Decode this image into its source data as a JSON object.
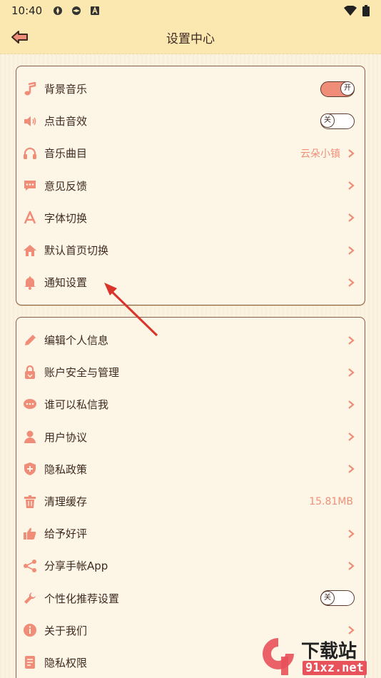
{
  "status": {
    "time": "10:40"
  },
  "header": {
    "title": "设置中心"
  },
  "card1": {
    "items": [
      {
        "label": "背景音乐",
        "type": "toggle",
        "state": "开"
      },
      {
        "label": "点击音效",
        "type": "toggle",
        "state": "关"
      },
      {
        "label": "音乐曲目",
        "type": "link",
        "value": "云朵小镇"
      },
      {
        "label": "意见反馈",
        "type": "link"
      },
      {
        "label": "字体切换",
        "type": "link"
      },
      {
        "label": "默认首页切换",
        "type": "link"
      },
      {
        "label": "通知设置",
        "type": "link"
      }
    ]
  },
  "card2": {
    "items": [
      {
        "label": "编辑个人信息"
      },
      {
        "label": "账户安全与管理"
      },
      {
        "label": "谁可以私信我"
      },
      {
        "label": "用户协议"
      },
      {
        "label": "隐私政策"
      },
      {
        "label": "清理缓存",
        "value": "15.81MB"
      },
      {
        "label": "给予好评"
      },
      {
        "label": "分享手帐App"
      },
      {
        "label": "个性化推荐设置",
        "state": "关"
      },
      {
        "label": "关于我们"
      },
      {
        "label": "隐私权限"
      }
    ]
  },
  "watermark": {
    "brand": "下载站",
    "url": "91xz.net"
  },
  "colors": {
    "accent": "#f08d78",
    "header_bg": "#fbe8b0",
    "page_bg": "#fbf3df",
    "border": "#8a5a4a"
  }
}
